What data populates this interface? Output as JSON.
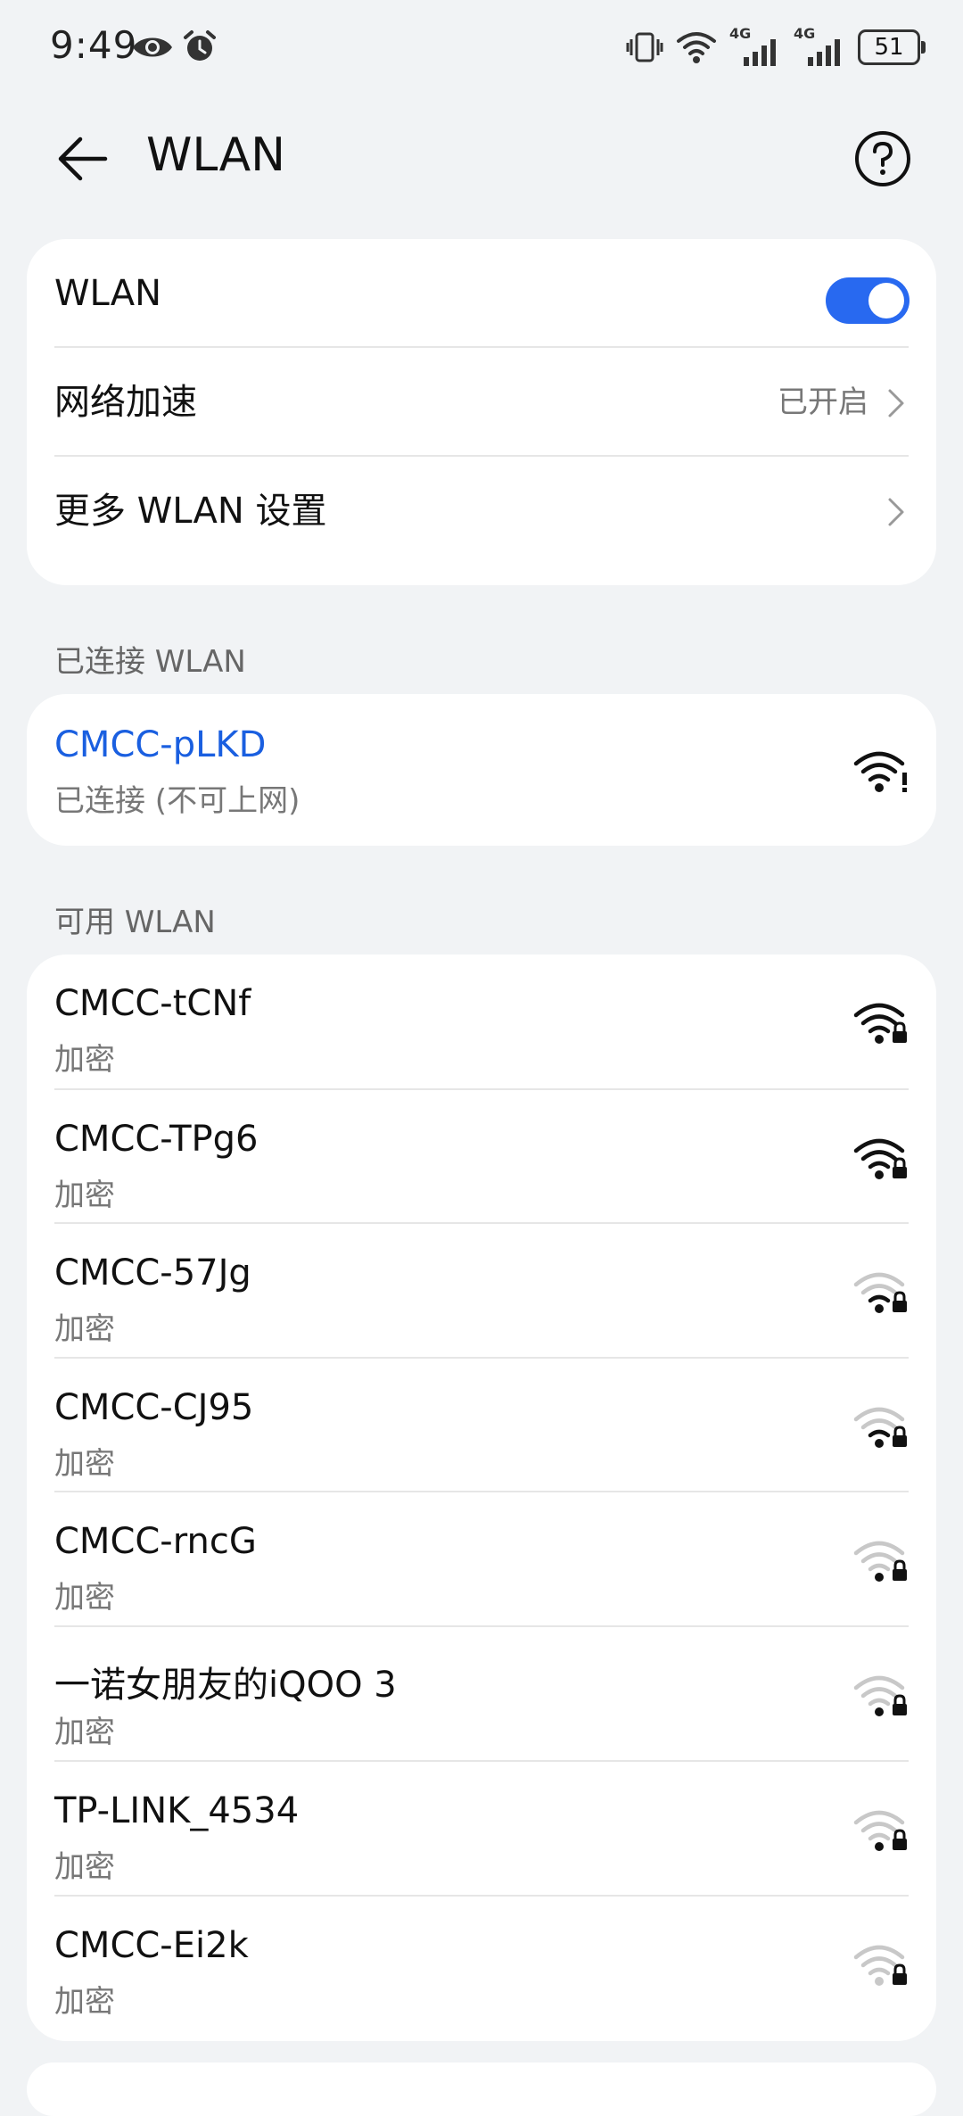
{
  "status_bar": {
    "time": "9:49",
    "network_1": "4G",
    "network_2": "4G",
    "battery": "51"
  },
  "header": {
    "title": "WLAN",
    "back_icon": "arrow-left-icon",
    "help_icon": "help-circle-icon"
  },
  "settings": {
    "wlan_label": "WLAN",
    "wlan_enabled": true,
    "accel_label": "网络加速",
    "accel_value": "已开启",
    "more_label": "更多 WLAN 设置"
  },
  "connected_section": {
    "title": "已连接 WLAN",
    "network": {
      "name": "CMCC-pLKD",
      "status": "已连接 (不可上网)"
    }
  },
  "available_section": {
    "title": "可用 WLAN",
    "networks": [
      {
        "name": "CMCC-tCNf",
        "security": "加密",
        "signal": 4
      },
      {
        "name": "CMCC-TPg6",
        "security": "加密",
        "signal": 4
      },
      {
        "name": "CMCC-57Jg",
        "security": "加密",
        "signal": 2
      },
      {
        "name": "CMCC-CJ95",
        "security": "加密",
        "signal": 2
      },
      {
        "name": "CMCC-rncG",
        "security": "加密",
        "signal": 1
      },
      {
        "name": "一诺女朋友的iQOO 3",
        "security": "加密",
        "signal": 1
      },
      {
        "name": "TP-LINK_4534",
        "security": "加密",
        "signal": 1
      },
      {
        "name": "CMCC-Ei2k",
        "security": "加密",
        "signal": 0
      }
    ]
  },
  "colors": {
    "accent": "#2869f0",
    "connected_text": "#1a5fe0",
    "background": "#f1f3f5"
  }
}
